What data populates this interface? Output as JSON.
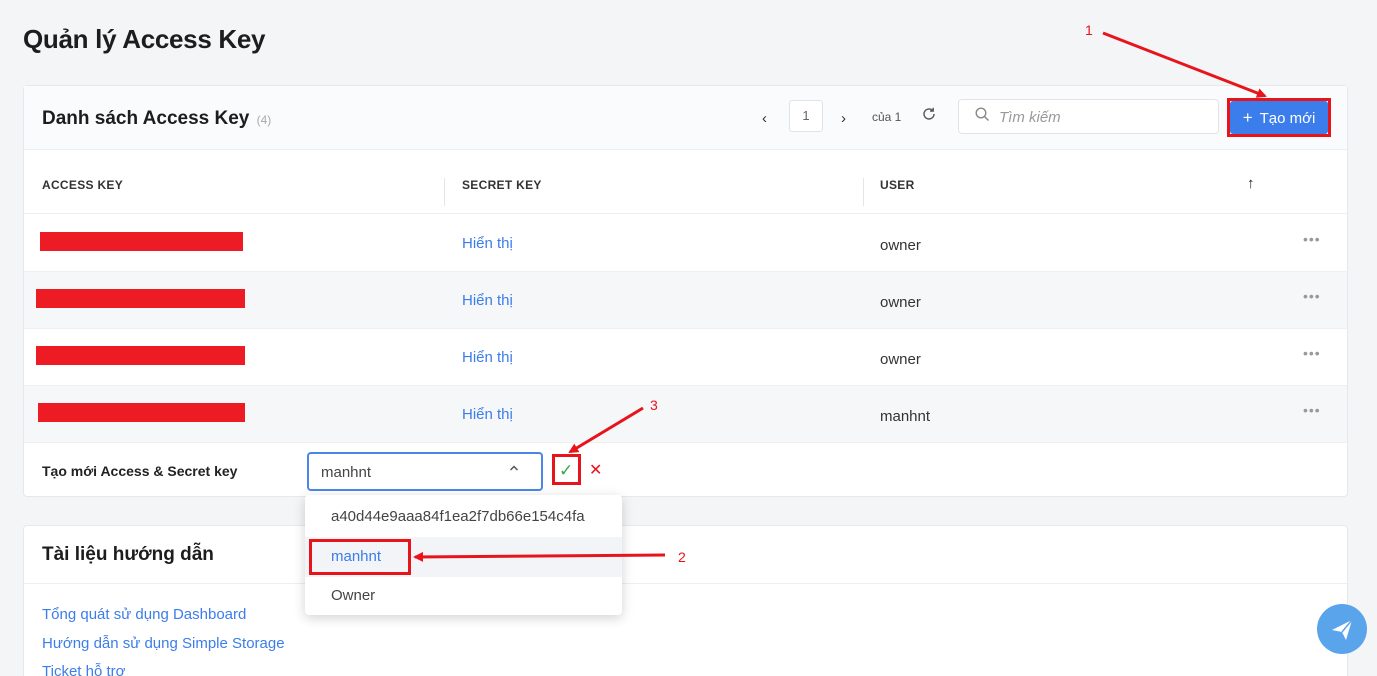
{
  "page": {
    "title": "Quản lý Access Key"
  },
  "list": {
    "title": "Danh sách Access Key",
    "count": "(4)",
    "pager": {
      "prev": "‹",
      "next": "›",
      "current": "1",
      "of_label": "của 1"
    },
    "search_placeholder": "Tìm kiếm",
    "create_button": {
      "plus": "+",
      "label": "Tạo mới"
    },
    "columns": [
      "ACCESS KEY",
      "SECRET KEY",
      "USER"
    ],
    "sort_icon": "↑",
    "rows": [
      {
        "secret": "Hiển thị",
        "user": "owner"
      },
      {
        "secret": "Hiển thị",
        "user": "owner"
      },
      {
        "secret": "Hiển thị",
        "user": "owner"
      },
      {
        "secret": "Hiển thị",
        "user": "manhnt"
      }
    ],
    "more": "•••"
  },
  "create_row": {
    "label": "Tạo mới Access & Secret key",
    "selected_user": "manhnt",
    "confirm": "✓",
    "cancel": "✕"
  },
  "dropdown_options": [
    "a40d44e9aaa84f1ea2f7db66e154c4fa",
    "manhnt",
    "Owner"
  ],
  "docs": {
    "title": "Tài liệu hướng dẫn",
    "links": [
      "Tổng quát sử dụng Dashboard",
      "Hướng dẫn sử dụng Simple Storage",
      "Ticket hỗ trợ"
    ]
  },
  "annotations": [
    "1",
    "2",
    "3"
  ],
  "colors": {
    "accent": "#3b7dea",
    "highlight": "#e8141c",
    "redaction": "#ed1c24",
    "confirm": "#39a845",
    "fab": "#5aa4ec"
  },
  "icons": [
    "chevron-left-icon",
    "chevron-right-icon",
    "refresh-icon",
    "search-icon",
    "plus-icon",
    "sort-up-icon",
    "more-icon",
    "chevron-up-icon",
    "check-icon",
    "close-icon",
    "send-icon"
  ]
}
